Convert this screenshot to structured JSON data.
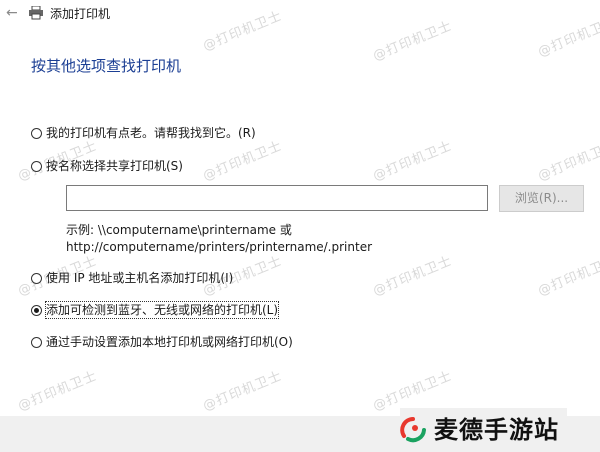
{
  "window": {
    "title": "添加打印机"
  },
  "dialog": {
    "heading": "按其他选项查找打印机"
  },
  "options": [
    {
      "label": "我的打印机有点老。请帮我找到它。(R)",
      "checked": false
    },
    {
      "label": "按名称选择共享打印机(S)",
      "checked": false
    },
    {
      "label": "使用 IP 地址或主机名添加打印机(I)",
      "checked": false
    },
    {
      "label": "添加可检测到蓝牙、无线或网络的打印机(L)",
      "checked": true
    },
    {
      "label": "通过手动设置添加本地打印机或网络打印机(O)",
      "checked": false
    }
  ],
  "share_input": {
    "value": "",
    "browse_label": "浏览(R)..."
  },
  "example": {
    "line1": "示例: \\\\computername\\printername 或",
    "line2": "http://computername/printers/printername/.printer"
  },
  "watermark": "@打印机卫士",
  "brand": {
    "name": "麦德手游站",
    "colors": {
      "red": "#e8382e",
      "green": "#1aa260"
    }
  }
}
